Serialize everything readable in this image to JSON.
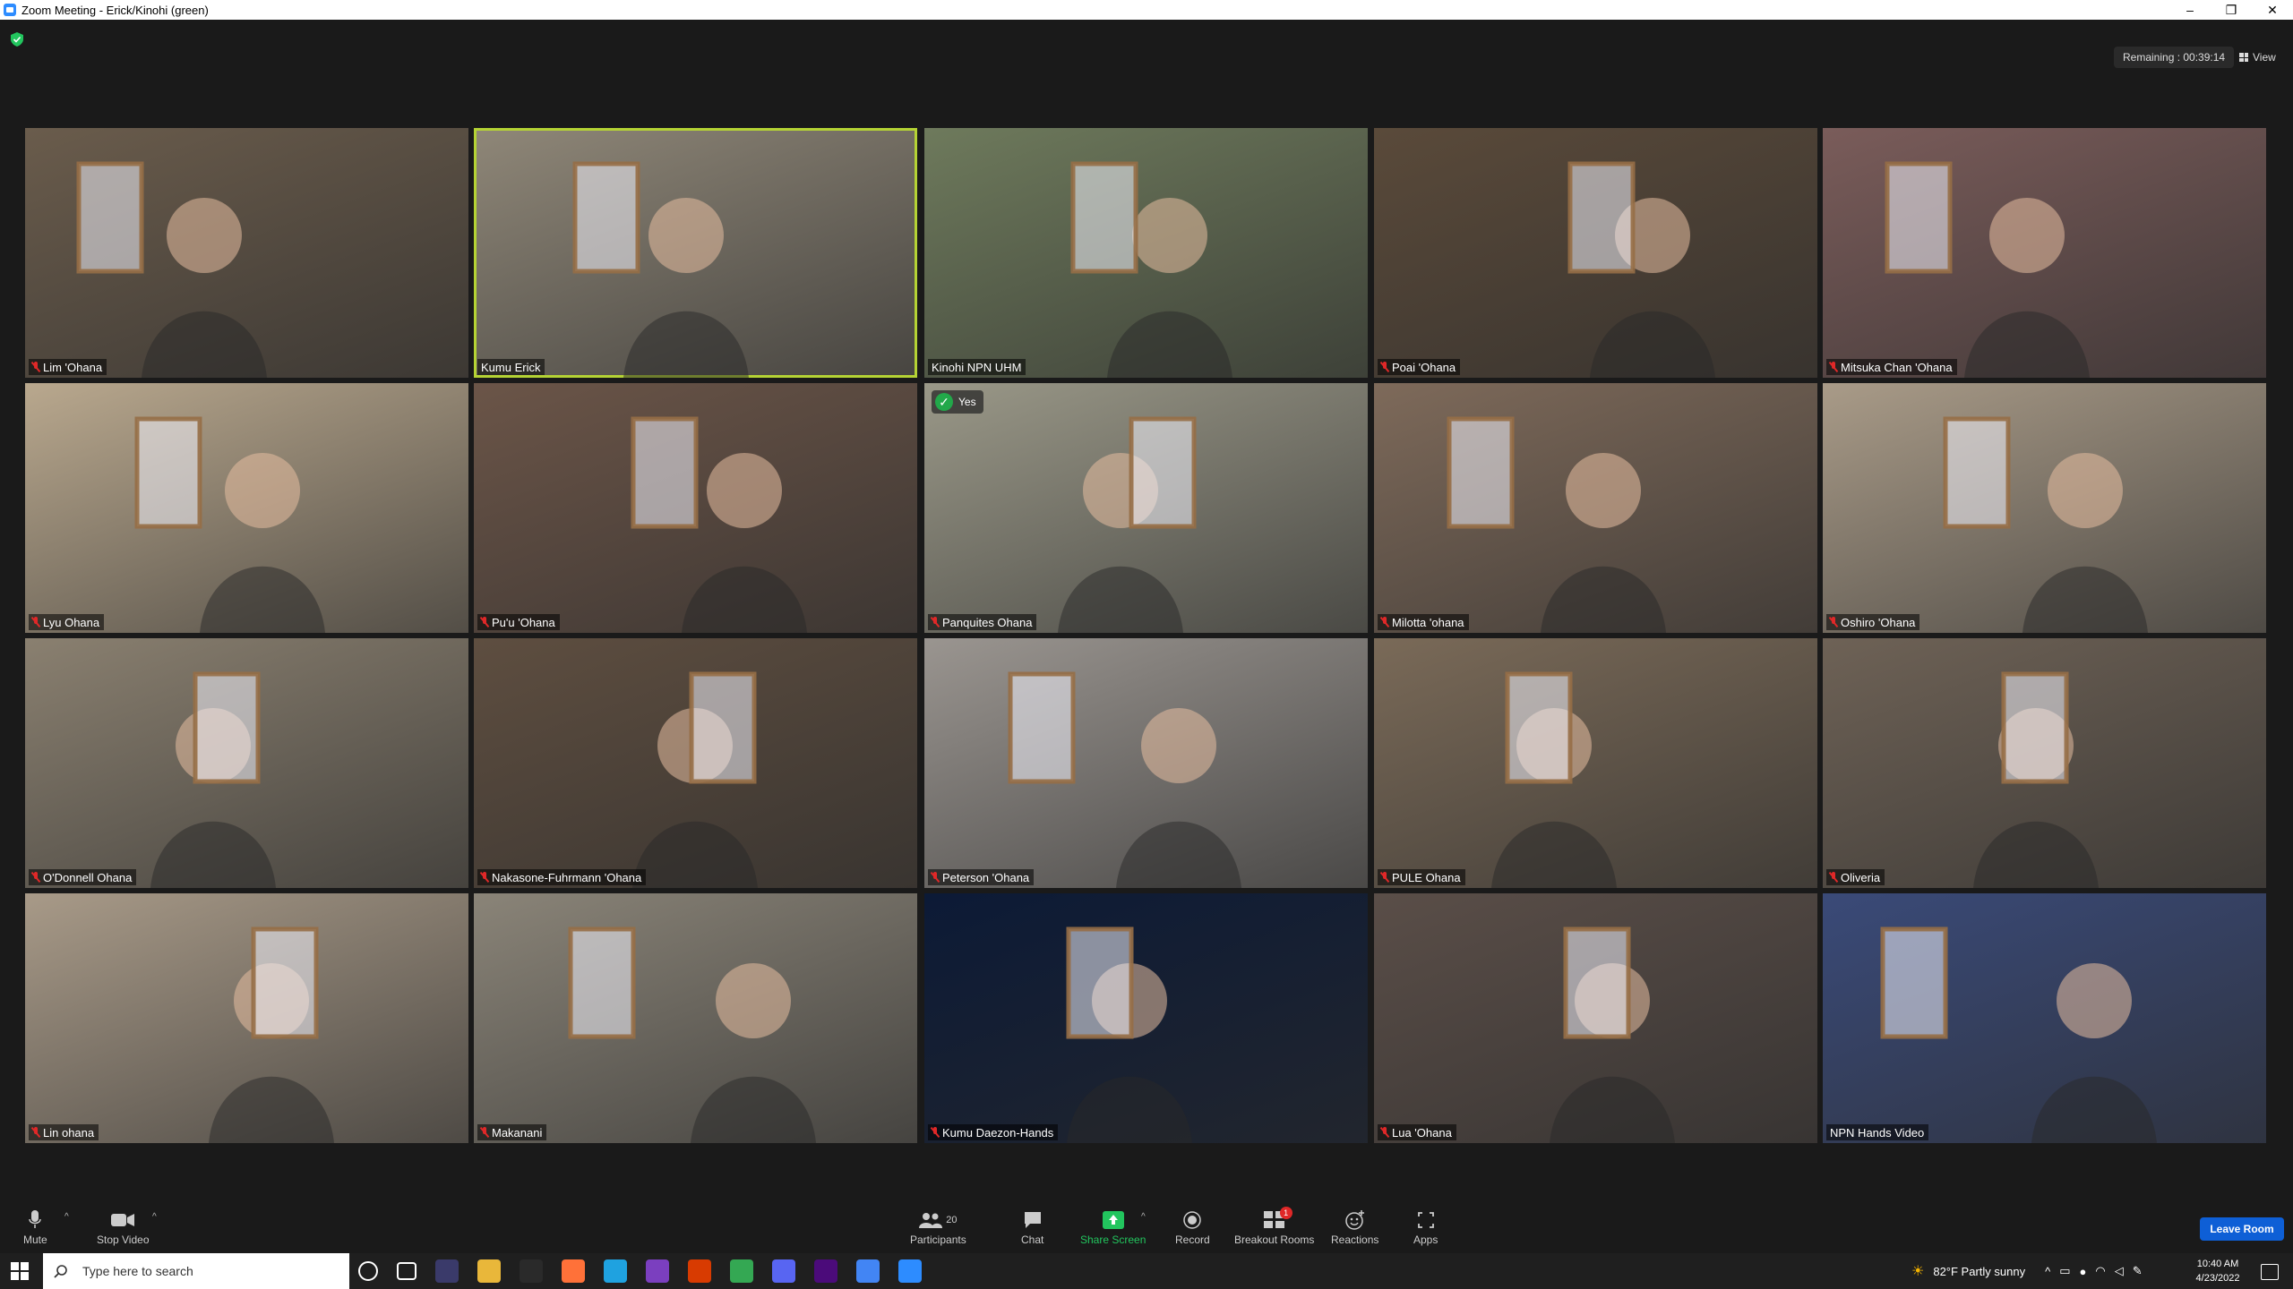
{
  "window": {
    "title": "Zoom Meeting - Erick/Kinohi (green)",
    "controls": [
      "–",
      "❐",
      "✕"
    ]
  },
  "meeting": {
    "remaining": "Remaining : 00:39:14",
    "view_label": "View",
    "security_icon": "shield-check-icon"
  },
  "participants": [
    {
      "name": "Lim 'Ohana",
      "muted": true,
      "active": false,
      "bg": "#6a5c4c"
    },
    {
      "name": "Kumu Erick",
      "muted": false,
      "active": true,
      "bg": "#8f8778"
    },
    {
      "name": "Kinohi NPN UHM",
      "muted": false,
      "active": false,
      "bg": "#6e7a5c"
    },
    {
      "name": "Poai 'Ohana",
      "muted": true,
      "active": false,
      "bg": "#5a4a3a"
    },
    {
      "name": "Mitsuka Chan 'Ohana",
      "muted": true,
      "active": false,
      "bg": "#7a5c5a"
    },
    {
      "name": "Lyu Ohana",
      "muted": true,
      "active": false,
      "bg": "#b9a88e"
    },
    {
      "name": "Pu'u 'Ohana",
      "muted": true,
      "active": false,
      "bg": "#6b5548"
    },
    {
      "name": "Panquites Ohana",
      "muted": true,
      "active": false,
      "bg": "#9a9888",
      "badge": "Yes"
    },
    {
      "name": "Milotta 'ohana",
      "muted": true,
      "active": false,
      "bg": "#7e6a5a"
    },
    {
      "name": "Oshiro 'Ohana",
      "muted": true,
      "active": false,
      "bg": "#a99b88"
    },
    {
      "name": "O'Donnell Ohana",
      "muted": true,
      "active": false,
      "bg": "#8a8070"
    },
    {
      "name": "Nakasone-Fuhrmann 'Ohana",
      "muted": true,
      "active": false,
      "bg": "#5e4e40"
    },
    {
      "name": "Peterson 'Ohana",
      "muted": true,
      "active": false,
      "bg": "#9a9590"
    },
    {
      "name": "PULE Ohana",
      "muted": true,
      "active": false,
      "bg": "#7a6a58"
    },
    {
      "name": "Oliveria",
      "muted": true,
      "active": false,
      "bg": "#6e6256"
    },
    {
      "name": "Lin ohana",
      "muted": true,
      "active": false,
      "bg": "#a89a88"
    },
    {
      "name": "Makanani",
      "muted": true,
      "active": false,
      "bg": "#8a8478"
    },
    {
      "name": "Kumu Daezon-Hands",
      "muted": true,
      "active": false,
      "bg": "#0c1a36"
    },
    {
      "name": "Lua 'Ohana",
      "muted": true,
      "active": false,
      "bg": "#5a4e48"
    },
    {
      "name": "NPN Hands Video",
      "muted": false,
      "active": false,
      "bg": "#3a4a78"
    }
  ],
  "toolbar": {
    "mute": "Mute",
    "stop_video": "Stop Video",
    "participants": "Participants",
    "participants_count": "20",
    "chat": "Chat",
    "share_screen": "Share Screen",
    "record": "Record",
    "breakout_rooms": "Breakout Rooms",
    "breakout_badge": "1",
    "reactions": "Reactions",
    "apps": "Apps",
    "leave": "Leave Room"
  },
  "taskbar": {
    "search_placeholder": "Type here to search",
    "weather": "82°F  Partly sunny",
    "time": "10:40 AM",
    "date": "4/23/2022",
    "apps": [
      "cortana-icon",
      "task-view-icon",
      "obs-icon",
      "file-explorer-icon",
      "terminal-icon",
      "firefox-icon",
      "edge-icon",
      "visual-studio-icon",
      "office-icon",
      "chrome-icon",
      "discord-icon",
      "premiere-icon",
      "chrome-alt-icon",
      "zoom-icon"
    ],
    "app_colors": [
      "#1f1f1f",
      "#1f1f1f",
      "#3a3a6a",
      "#e9b73a",
      "#2a2a2a",
      "#ff7139",
      "#1fa2e0",
      "#7b3fbf",
      "#d83b01",
      "#34a853",
      "#5865f2",
      "#4b0b7a",
      "#4285f4",
      "#2d8cff"
    ]
  }
}
